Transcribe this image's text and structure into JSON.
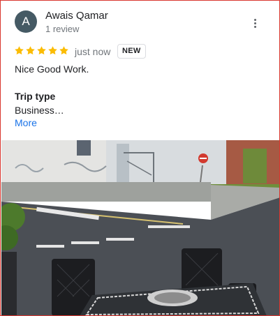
{
  "reviewer": {
    "avatar_initial": "A",
    "name": "Awais Qamar",
    "review_count": "1 review"
  },
  "rating": {
    "stars": 5,
    "max": 5,
    "color": "#fbbc04"
  },
  "posted": "just now",
  "badge": "NEW",
  "review_text": "Nice Good Work.",
  "trip": {
    "heading": "Trip type",
    "value": "Business…"
  },
  "more_label": "More",
  "icons": {
    "menu": "more-vert-icon",
    "star": "star-icon"
  },
  "colors": {
    "avatar_bg": "#455a64",
    "link": "#1a73e8",
    "frame": "#d9372f"
  }
}
